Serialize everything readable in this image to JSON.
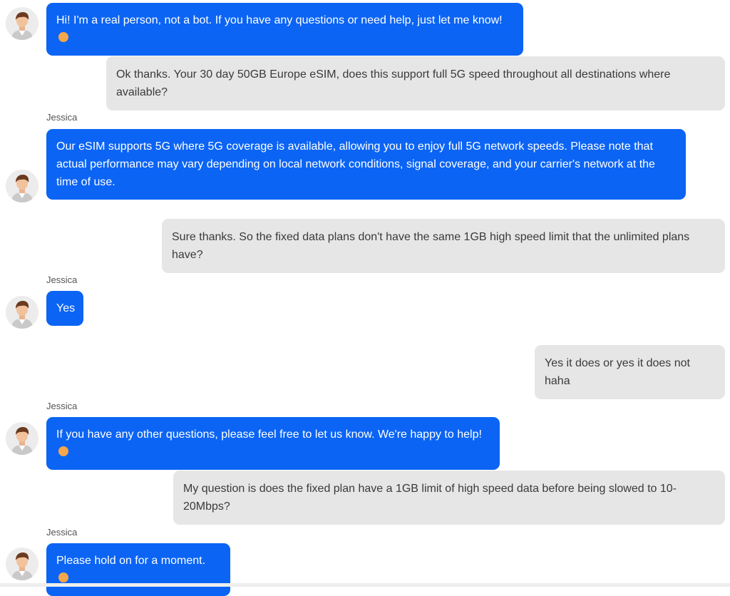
{
  "agent_name": "Jessica",
  "messages": [
    {
      "sender": "agent",
      "text": "Hi! I'm a real person, not a bot. If you have any questions or need help, just let me know!",
      "emoji": "smiling-face"
    },
    {
      "sender": "user",
      "text": "Ok thanks. Your 30 day 50GB Europe eSIM, does this support full 5G speed throughout all destinations where available?"
    },
    {
      "sender": "agent",
      "name": "Jessica",
      "text": "Our eSIM supports 5G where 5G coverage is available, allowing you to enjoy full 5G network speeds. Please note that actual performance may vary depending on local network conditions, signal coverage, and your carrier's network at the time of use."
    },
    {
      "sender": "user",
      "text": "Sure thanks. So the fixed data plans don't have the same 1GB high speed limit that the unlimited plans have?"
    },
    {
      "sender": "agent",
      "name": "Jessica",
      "text": "Yes"
    },
    {
      "sender": "user",
      "text": "Yes it does or yes it does not haha"
    },
    {
      "sender": "agent",
      "name": "Jessica",
      "text": "If you have any other questions, please feel free to let us know. We're happy to help!",
      "emoji": "smiling-face"
    },
    {
      "sender": "user",
      "text": "My question is does the fixed plan have a 1GB limit of high speed data before being slowed to 10-20Mbps?"
    },
    {
      "sender": "agent",
      "name": "Jessica",
      "text": "Please hold on for a moment.",
      "emoji": "smiling-face"
    }
  ],
  "colors": {
    "agent_bubble": "#0b64f4",
    "user_bubble": "#e6e6e6"
  }
}
